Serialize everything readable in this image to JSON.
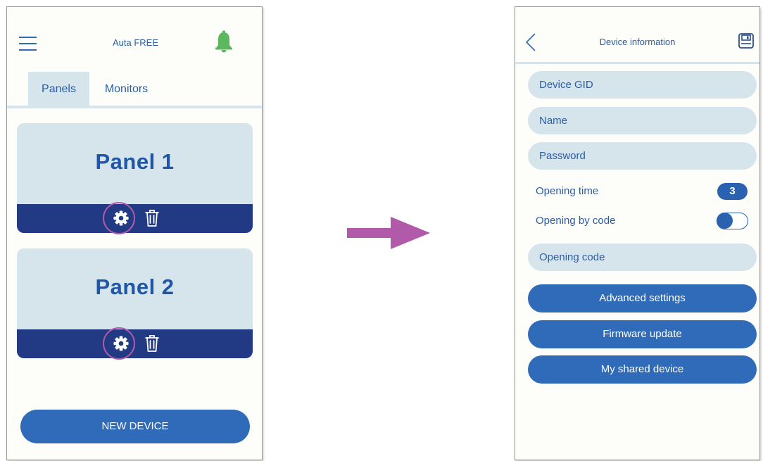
{
  "left_screen": {
    "app_title": "Auta FREE",
    "icons": {
      "menu": "hamburger-icon",
      "notifications": "bell-icon"
    },
    "tabs": [
      {
        "label": "Panels",
        "active": true
      },
      {
        "label": "Monitors",
        "active": false
      }
    ],
    "panels": [
      {
        "title": "Panel 1",
        "actions": [
          "gear-icon",
          "trash-icon"
        ],
        "highlighted_action": "gear-icon"
      },
      {
        "title": "Panel 2",
        "actions": [
          "gear-icon",
          "trash-icon"
        ],
        "highlighted_action": "gear-icon"
      }
    ],
    "new_device_label": "NEW DEVICE"
  },
  "flow_arrow": {
    "icon": "arrow-right-icon"
  },
  "right_screen": {
    "title": "Device information",
    "icons": {
      "back": "chevron-left-icon",
      "save": "save-icon"
    },
    "fields": {
      "device_gid": {
        "placeholder": "Device GID"
      },
      "name": {
        "placeholder": "Name"
      },
      "password": {
        "placeholder": "Password"
      },
      "opening_code": {
        "placeholder": "Opening code"
      }
    },
    "opening_time": {
      "label": "Opening time",
      "value": "3"
    },
    "opening_by_code": {
      "label": "Opening by code",
      "enabled": false
    },
    "buttons": {
      "advanced": "Advanced settings",
      "firmware": "Firmware update",
      "shared": "My shared device"
    }
  },
  "colors": {
    "brand_blue": "#2f6bb8",
    "dark_blue": "#213a83",
    "light_blue": "#d6e4ec",
    "highlight_ring": "#b05aa9",
    "bell_green": "#5cb85c",
    "arrow": "#b05aa9"
  }
}
